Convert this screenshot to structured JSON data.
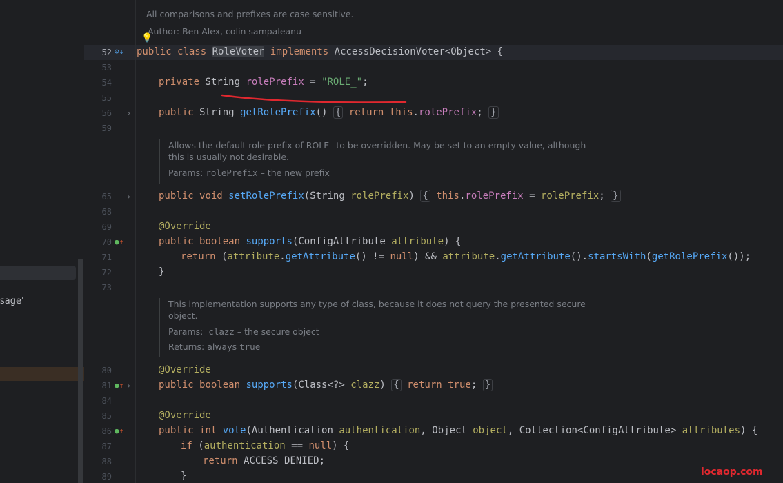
{
  "sidebar": {
    "fragment_text": "sage'"
  },
  "doc_header": {
    "line1": "All comparisons and prefixes are case sensitive.",
    "author": "Author: Ben Alex, colin sampaleanu"
  },
  "line_numbers": [
    "52",
    "53",
    "54",
    "55",
    "56",
    "59",
    "65",
    "68",
    "69",
    "70",
    "71",
    "72",
    "73",
    "80",
    "81",
    "84",
    "85",
    "86",
    "87",
    "88",
    "89"
  ],
  "code": {
    "class_decl": {
      "kw1": "public",
      "kw2": "class",
      "name": "RoleVoter",
      "kw3": "implements",
      "iface": "AccessDecisionVoter",
      "generic": "<Object>",
      "brace": " {"
    },
    "field": {
      "mod": "private",
      "type": "String",
      "name": "rolePrefix",
      "eq": " = ",
      "value": "\"ROLE_\"",
      "semi": ";"
    },
    "getter": {
      "mod": "public",
      "type": "String",
      "name": "getRolePrefix",
      "parens": "()",
      "body_kw": "return",
      "this": "this",
      "field": "rolePrefix",
      "end": ";"
    },
    "doc_setter": {
      "text": "Allows the default role prefix of ROLE_ to be overridden. May be set to an empty value, although this is usually not desirable.",
      "params_label": "Params:",
      "params_name": "rolePrefix",
      "params_desc": " – the new prefix"
    },
    "setter": {
      "mod": "public",
      "type": "void",
      "name": "setRolePrefix",
      "ptype": "String",
      "pname": "rolePrefix",
      "this": "this",
      "field": "rolePrefix",
      "assign": " = ",
      "val": "rolePrefix",
      "end": ";"
    },
    "supports1": {
      "ann": "@Override",
      "mod": "public",
      "type": "boolean",
      "name": "supports",
      "ptype": "ConfigAttribute",
      "pname": "attribute",
      "body": "return",
      "close": "}"
    },
    "supports1_body": {
      "p1": "attribute",
      "m1": "getAttribute",
      "neq": " != ",
      "nul": "null",
      "and": " && ",
      "p2": "attribute",
      "m2": "getAttribute",
      "m3": "startsWith",
      "m4": "getRolePrefix"
    },
    "doc_supports2": {
      "text": "This implementation supports any type of class, because it does not query the presented secure object.",
      "params_label": "Params:",
      "params_name": "clazz",
      "params_desc": " – the secure object",
      "returns_label": "Returns:",
      "returns_text": "always",
      "returns_val": "true"
    },
    "supports2": {
      "ann": "@Override",
      "mod": "public",
      "type": "boolean",
      "name": "supports",
      "ptype": "Class",
      "generic": "<?>",
      "pname": "clazz",
      "body": "return",
      "val": "true"
    },
    "vote": {
      "ann": "@Override",
      "mod": "public",
      "type": "int",
      "name": "vote",
      "t1": "Authentication",
      "p1": "authentication",
      "t2": "Object",
      "p2": "object",
      "t3": "Collection",
      "g3": "<ConfigAttribute>",
      "p3": "attributes"
    },
    "vote_if": {
      "kw": "if",
      "p": "authentication",
      "op": " == ",
      "nul": "null"
    },
    "vote_ret": {
      "kw": "return",
      "const": "ACCESS_DENIED"
    },
    "vote_close": "}"
  },
  "watermark": "iocaop.com",
  "colors": {
    "keyword": "#cf8e6d",
    "string": "#6aab73",
    "field": "#c77dbb",
    "method": "#56a8f5",
    "annotation": "#b3ae60",
    "annotation_mark": "#e0282f"
  }
}
